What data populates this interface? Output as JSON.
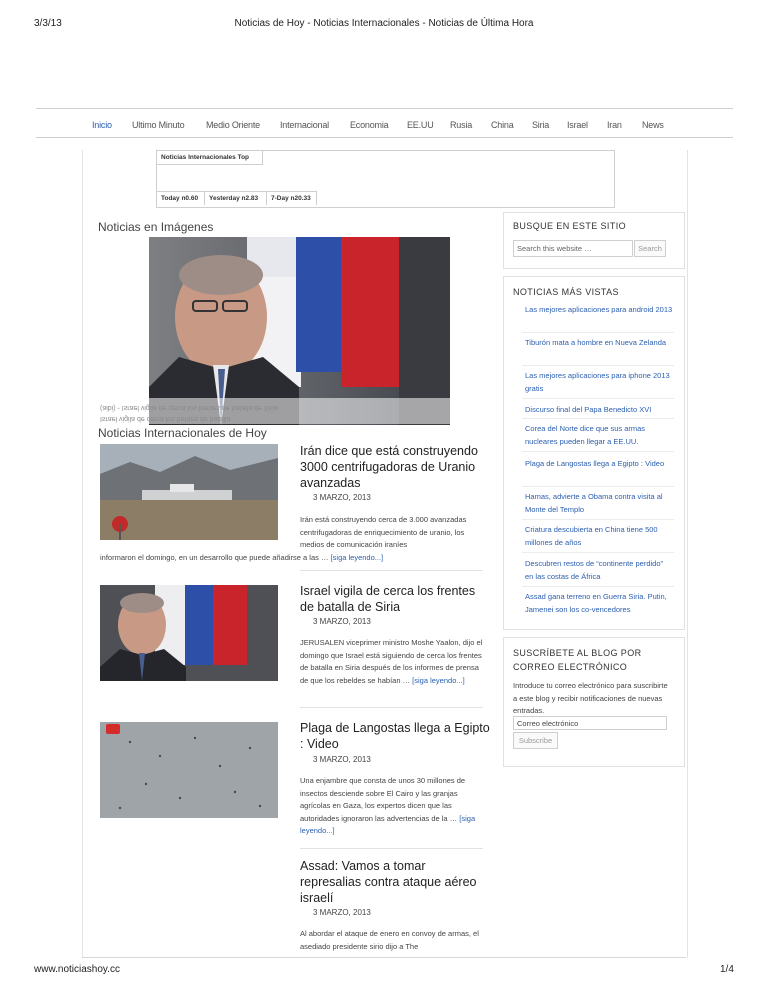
{
  "print": {
    "date": "3/3/13",
    "page_title": "Noticias de Hoy - Noticias Internacionales - Noticias de Última Hora",
    "url": "www.noticiashoy.cc",
    "page_count": "1/4"
  },
  "nav": {
    "items": [
      "Inicio",
      "Ultimo Minuto",
      "Medio Oriente",
      "Internacional",
      "Economia",
      "EE.UU",
      "Rusia",
      "China",
      "Siria",
      "Israel",
      "Iran",
      "News"
    ],
    "active": "Inicio"
  },
  "stats": {
    "title": "Noticias Internacionales Top",
    "today": "Today n0.60",
    "yesterday": "Yesterday n2.83",
    "week": "7-Day n20.33"
  },
  "gallery": {
    "heading": "Noticias en Imágenes",
    "caption_line1": "Israel vigila de cerca los frentes de batalla",
    "caption_line2": "(aibi) - Israel vigila de cerca los frentes de batalla de Siria"
  },
  "news": {
    "heading": "Noticias Internacionales de Hoy",
    "posts": [
      {
        "title": "Irán dice que está construyendo 3000 centrifugadoras de Uranio avanzadas",
        "date": "3 MARZO, 2013",
        "excerpt": "Irán está construyendo cerca de 3.000 avanzadas centrifugadoras de enriquecimiento de uranio, los medios de comunicación iraníes",
        "excerpt_wide": "informaron el domingo, en un desarrollo que puede añadirse a las …",
        "more": "[siga leyendo...]"
      },
      {
        "title": "Israel vigila de cerca los frentes de batalla de Siria",
        "date": "3 MARZO, 2013",
        "excerpt": "JERUSALEN viceprimer ministro Moshe Yaalon, dijo el domingo que Israel está siguiendo de cerca los frentes de batalla en Siria después de los informes de prensa de que los rebeldes se habían …",
        "more": "[siga leyendo...]"
      },
      {
        "title": "Plaga de Langostas llega a Egipto : Video",
        "date": "3 MARZO, 2013",
        "excerpt": "Una enjambre que consta de unos 30 millones de insectos desciende sobre El Cairo y las granjas agrícolas en Gaza, los expertos dicen que las autoridades ignoraron las advertencias de la …",
        "more": "[siga leyendo...]"
      },
      {
        "title": "Assad: Vamos a tomar represalias contra ataque aéreo israelí",
        "date": "3 MARZO, 2013",
        "excerpt": "Al abordar el ataque de enero en convoy de armas, el asediado presidente sirio dijo a The"
      }
    ]
  },
  "sidebar": {
    "search": {
      "title": "BUSQUE EN ESTE SITIO",
      "placeholder": "Search this website …",
      "button": "Search"
    },
    "popular": {
      "title": "NOTICIAS MÁS VISTAS",
      "items": [
        "Las mejores aplicaciones para android 2013",
        "Tiburón mata a hombre en Nueva Zelanda",
        "Las mejores aplicaciones para iphone 2013 gratis",
        "Discurso final del Papa Benedicto XVI",
        "Corea del Norte dice que sus armas nucleares pueden llegar a EE.UU.",
        "Plaga de Langostas llega a Egipto : Video",
        "Hamas, advierte a Obama contra visita al Monte del Templo",
        "Criatura descubierta en China tiene 500 millones de años",
        "Descubren restos de “continente perdido” en las costas de África",
        "Assad gana terreno en Guerra Siria. Putin, Jamenei son los co-vencedores"
      ]
    },
    "subscribe": {
      "title_line1": "SUSCRÍBETE AL BLOG POR",
      "title_line2": "CORREO ELECTRÓNICO",
      "text": "Introduce tu correo electrónico para suscribirte a este blog y recibir notificaciones de nuevas entradas.",
      "placeholder": "Correo electrónico",
      "button": "Subscribe"
    }
  },
  "colors": {
    "link": "#2b5fb0",
    "border": "#cfcfcf"
  }
}
